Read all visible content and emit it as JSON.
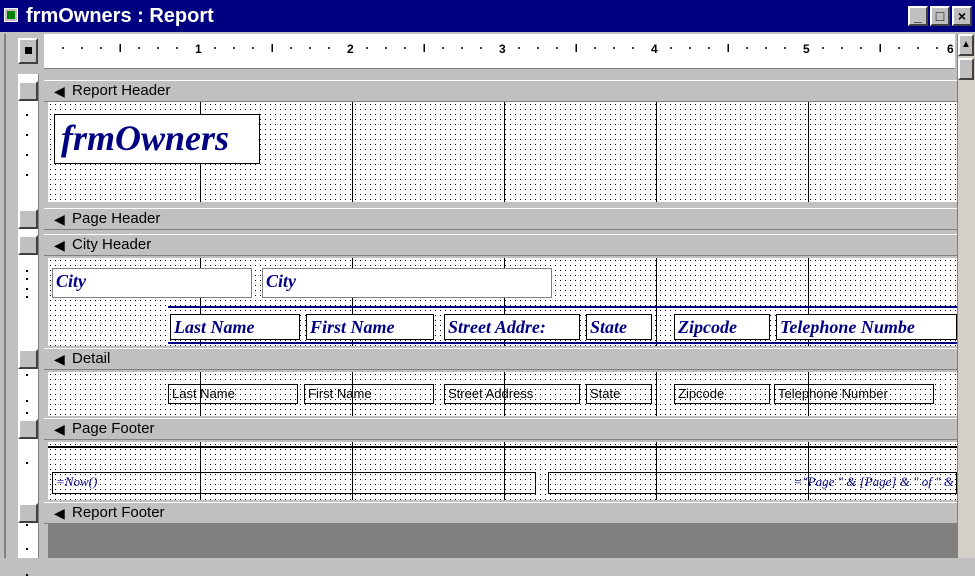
{
  "window": {
    "title": "frmOwners : Report",
    "minimize": "_",
    "restore": "□",
    "close": "×"
  },
  "ruler": {
    "marks": [
      "1",
      "2",
      "3",
      "4",
      "5",
      "6"
    ]
  },
  "sections": {
    "report_header": "Report Header",
    "page_header": "Page Header",
    "city_header": "City Header",
    "detail": "Detail",
    "page_footer": "Page Footer",
    "report_footer": "Report Footer"
  },
  "report_header": {
    "title": "frmOwners"
  },
  "city_header": {
    "city_label": "City",
    "city_field": "City",
    "columns": [
      "Last Name",
      "First Name",
      "Street Addre:",
      "State",
      "Zipcode",
      "Telephone Numbe"
    ]
  },
  "detail": {
    "fields": [
      "Last Name",
      "First Name",
      "Street Address",
      "State",
      "Zipcode",
      "Telephone Number"
    ]
  },
  "page_footer": {
    "now_expr": "=Now()",
    "page_expr": "=\"Page \" & [Page] & \" of \" &"
  },
  "colors": {
    "titlebar": "#000080",
    "accent_text": "#000080",
    "face": "#c0c0c0"
  }
}
